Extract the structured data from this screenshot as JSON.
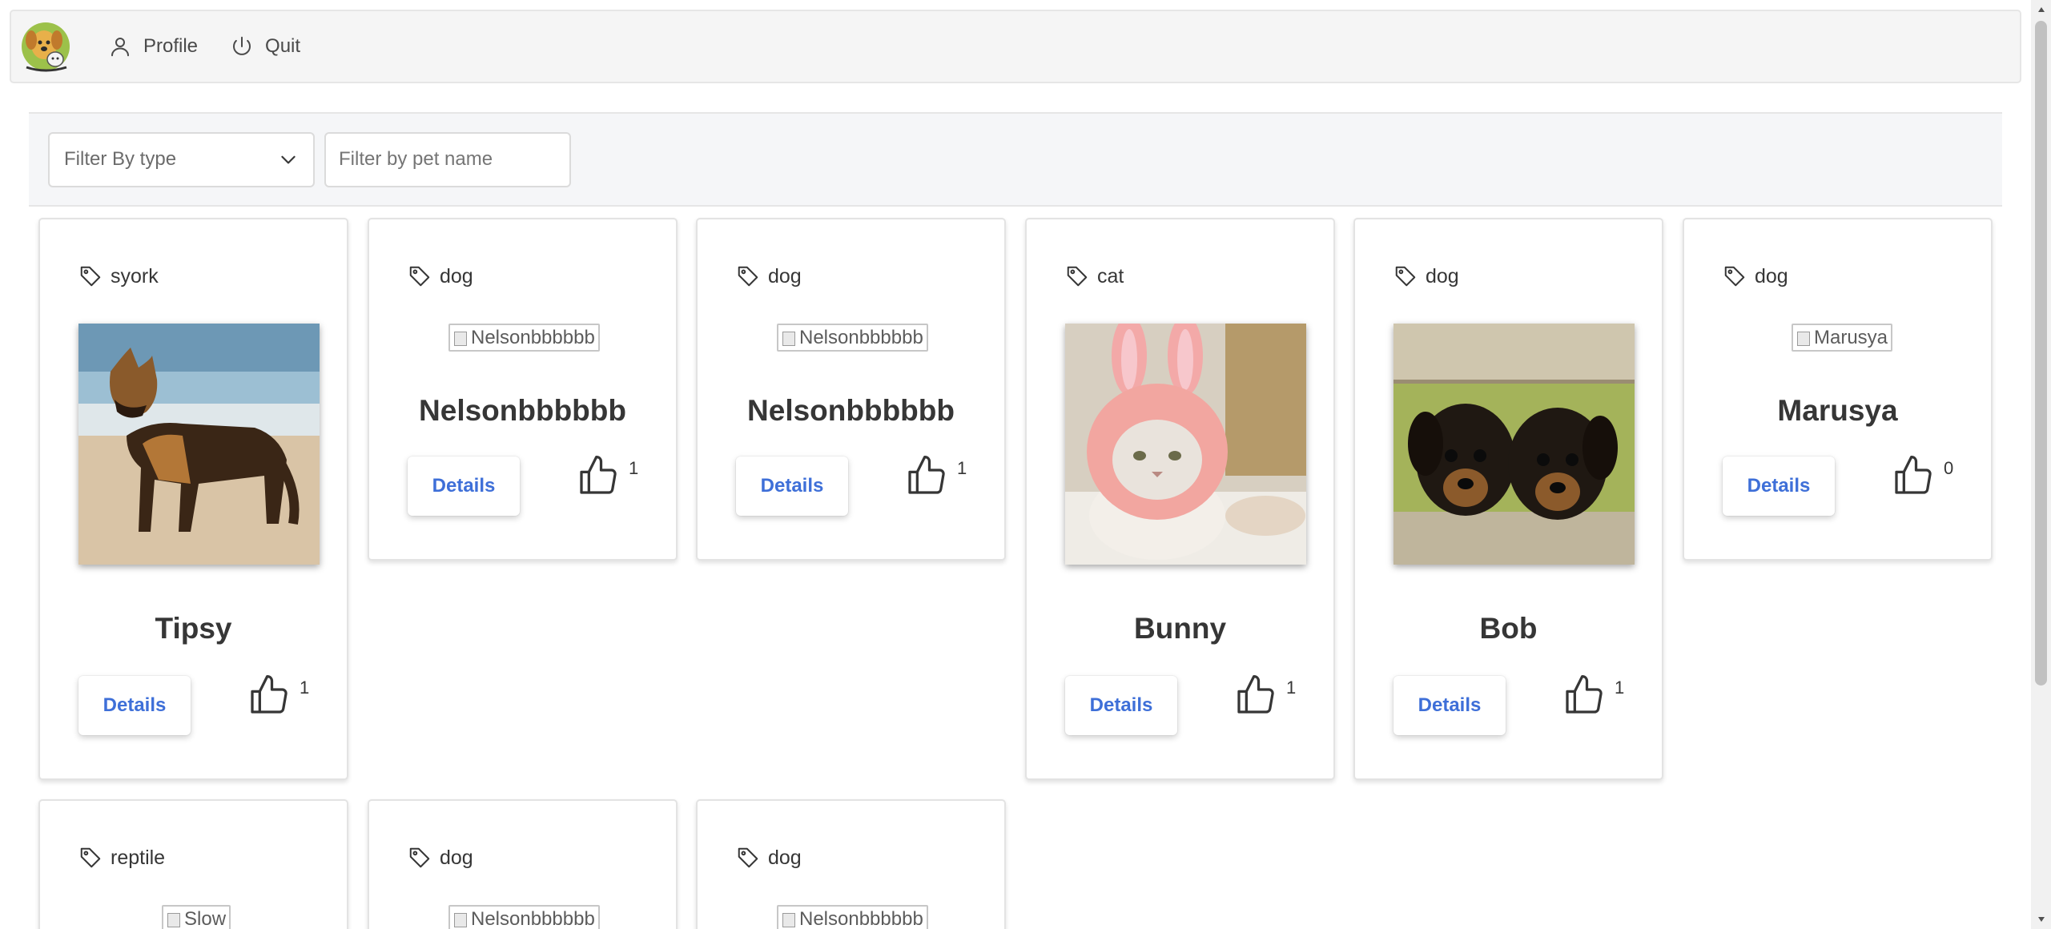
{
  "nav": {
    "logo_icon": "pets-logo-icon",
    "profile_label": "Profile",
    "quit_label": "Quit"
  },
  "filters": {
    "type_select_value": "Filter By type",
    "name_placeholder": "Filter by pet name"
  },
  "details_label": "Details",
  "pets": [
    {
      "type": "syork",
      "name": "Tipsy",
      "likes": "1",
      "image": "german-shepherd-photo"
    },
    {
      "type": "dog",
      "name": "Nelsonbbbbbb",
      "likes": "1",
      "image_alt": "Nelsonbbbbbb"
    },
    {
      "type": "dog",
      "name": "Nelsonbbbbbb",
      "likes": "1",
      "image_alt": "Nelsonbbbbbb"
    },
    {
      "type": "cat",
      "name": "Bunny",
      "likes": "1",
      "image": "cat-bunny-hat-photo"
    },
    {
      "type": "dog",
      "name": "Bob",
      "likes": "1",
      "image": "two-puppies-photo"
    },
    {
      "type": "dog",
      "name": "Marusya",
      "likes": "0",
      "image_alt": "Marusya"
    },
    {
      "type": "reptile",
      "image_alt": "Slow"
    },
    {
      "type": "dog",
      "image_alt": "Nelsonbbbbbb"
    },
    {
      "type": "dog",
      "image_alt": "Nelsonbbbbbb"
    }
  ],
  "colors": {
    "accent": "#3e6fd8",
    "navbar_bg": "#f5f5f5",
    "filterbar_bg": "#f5f6f8"
  }
}
